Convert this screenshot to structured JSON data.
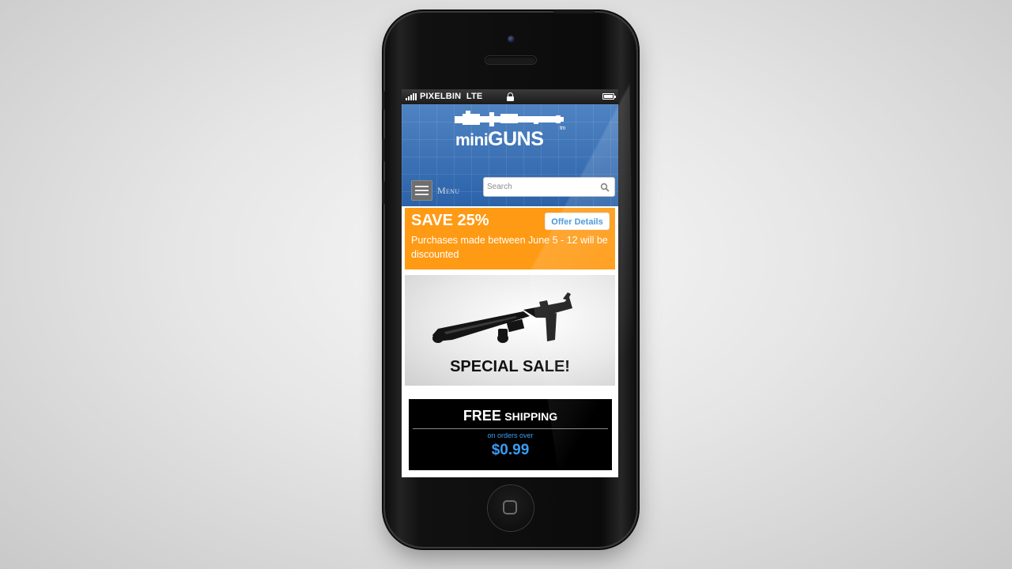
{
  "status_bar": {
    "carrier": "PIXELBIN",
    "network": "LTE"
  },
  "header": {
    "logo": {
      "prefix": "mini",
      "brand": "GUNS",
      "trademark": "tm"
    },
    "menu_label": "Menu",
    "search_placeholder": "Search"
  },
  "promo": {
    "title": "SAVE 25%",
    "button_label": "Offer Details",
    "description": "Purchases made between June 5 - 12 will be discounted",
    "color": "#ff9a14"
  },
  "sale_banner": {
    "text": "SPECIAL SALE!"
  },
  "shipping_banner": {
    "free": "FREE",
    "shipping": "SHIPPING",
    "subtext": "on orders over",
    "price": "$0.99",
    "accent": "#3c9bf0"
  }
}
